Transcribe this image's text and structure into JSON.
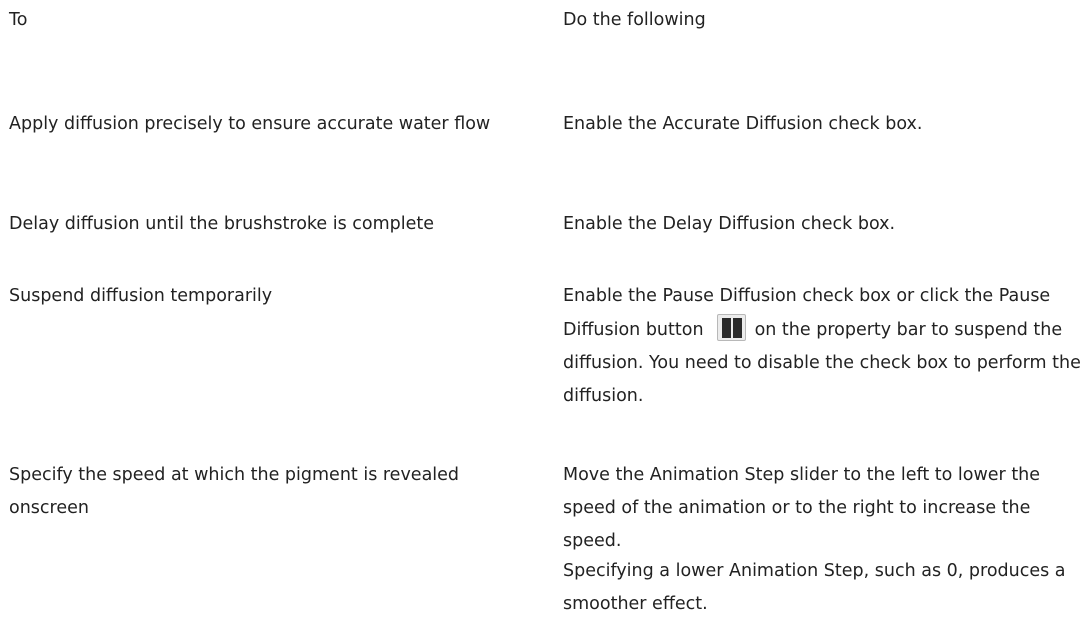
{
  "headers": {
    "col1": "To",
    "col2": "Do the following"
  },
  "rows": [
    {
      "task": "Apply diffusion precisely to ensure accurate water flow",
      "action": {
        "pre": "Enable the ",
        "ui": "Accurate Diffusion",
        "post": " check box."
      }
    },
    {
      "task": "Delay diffusion until the brushstroke is complete",
      "action": {
        "pre": "Enable the ",
        "ui": "Delay Diffusion",
        "post": " check box."
      }
    },
    {
      "task": "Suspend diffusion temporarily",
      "action": {
        "pre": "Enable the ",
        "ui": "Pause Diffusion",
        "mid": " check box or click the ",
        "ui2": "Pause Diffusion",
        "mid2": " button",
        "icon": "pause-icon",
        "post": "on the property bar to suspend the diffusion. You need to disable the check box to perform the diffusion."
      }
    },
    {
      "task": "Specify the speed at which the pigment is revealed onscreen",
      "action": {
        "pre": "Move the ",
        "ui": "Animation Step",
        "post": " slider to the left to lower the speed of the animation or to the right to increase the speed."
      },
      "note": {
        "pre": "Specifying a lower ",
        "ui": "Animation Step",
        "post": ", such as 0, produces a smoother effect."
      }
    }
  ]
}
